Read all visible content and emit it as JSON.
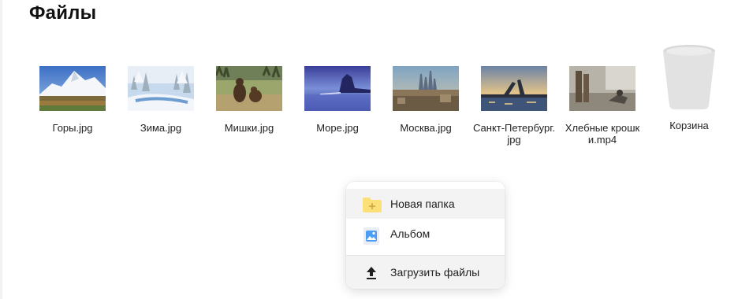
{
  "page": {
    "title": "Файлы"
  },
  "files": [
    {
      "name": "Горы.jpg",
      "thumb": "mountains-thumbnail"
    },
    {
      "name": "Зима.jpg",
      "thumb": "winter-thumbnail"
    },
    {
      "name": "Мишки.jpg",
      "thumb": "bears-thumbnail"
    },
    {
      "name": "Море.jpg",
      "thumb": "sea-thumbnail"
    },
    {
      "name": "Москва.jpg",
      "thumb": "moscow-thumbnail"
    },
    {
      "name": "Санкт-Петербург.jpg",
      "thumb": "saint-petersburg-thumbnail"
    },
    {
      "name": "Хлебные крошки.mp4",
      "thumb": "video-thumbnail"
    }
  ],
  "trash": {
    "label": "Корзина",
    "icon": "trash-bin-icon"
  },
  "context_menu": {
    "new_folder": {
      "label": "Новая папка",
      "icon": "folder-plus-icon"
    },
    "album": {
      "label": "Альбом",
      "icon": "album-icon"
    },
    "upload": {
      "label": "Загрузить файлы",
      "icon": "upload-icon"
    }
  },
  "colors": {
    "folder": "#fbe07a",
    "album": "#4e9df5",
    "menu_highlight": "#f3f3f3",
    "trash": "#e2e2e2"
  }
}
